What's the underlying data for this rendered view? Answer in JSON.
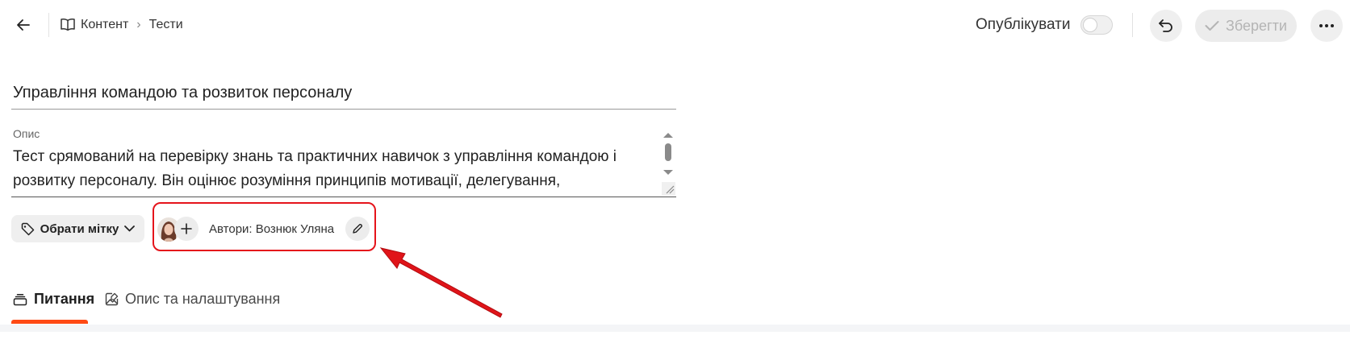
{
  "header": {
    "breadcrumb": {
      "section": "Контент",
      "page": "Тести"
    },
    "publish_label": "Опублікувати",
    "publish_on": false,
    "save_label": "Зберегти"
  },
  "form": {
    "title": "Управління командою та розвиток персоналу",
    "description_label": "Опис",
    "description": "Тест срямований на перевірку знань та практичних навичок з управління командою і розвитку персоналу. Він оцінює розуміння принципів мотивації, делегування,"
  },
  "meta": {
    "tag_button_label": "Обрати мітку",
    "authors_text": "Автори: Вознюк Уляна"
  },
  "tabs": [
    {
      "label": "Питання",
      "active": true
    },
    {
      "label": "Опис та налаштування",
      "active": false
    }
  ],
  "colors": {
    "accent": "#ff4a14",
    "highlight": "#e5141b"
  },
  "icons": [
    "arrow-left-icon",
    "book-icon",
    "undo-icon",
    "check-icon",
    "more-icon",
    "tag-icon",
    "chevron-down-icon",
    "plus-icon",
    "pencil-icon",
    "stack-icon",
    "image-edit-icon"
  ]
}
